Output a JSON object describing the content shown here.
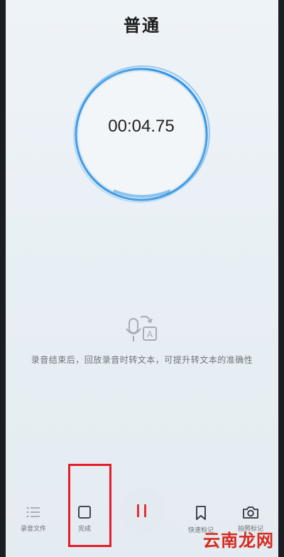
{
  "header": {
    "title": "普通"
  },
  "recorder": {
    "timer": "00:04.75"
  },
  "hint": {
    "text": "录音结束后，回放录音时转文本，可提升转文本的准确性"
  },
  "toolbar": {
    "files_label": "录音文件",
    "done_label": "完成",
    "mark_label": "快速标记",
    "photo_label": "拍照标记"
  },
  "watermark": {
    "text": "云南龙网"
  },
  "colors": {
    "accent": "#2b8fe0",
    "pause": "#e0323a",
    "highlight": "#e51d2a"
  }
}
